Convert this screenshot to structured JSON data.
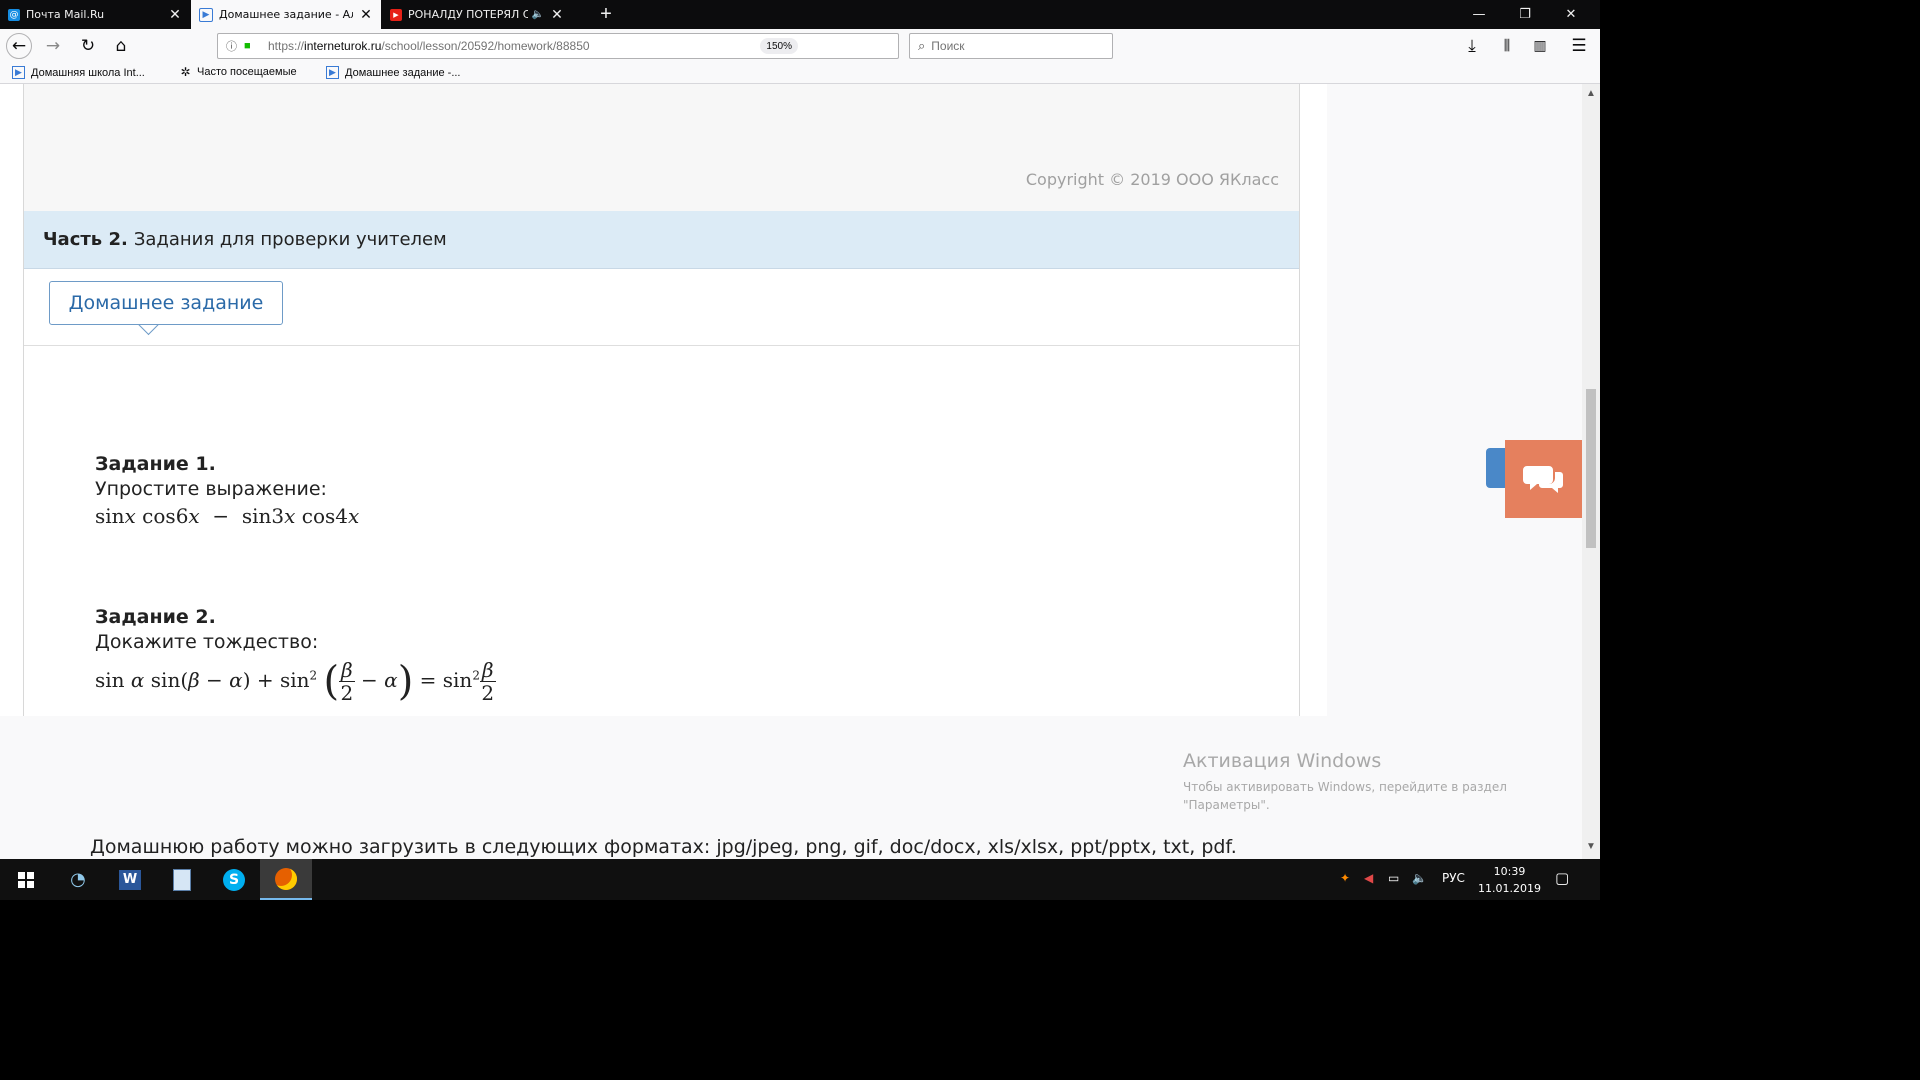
{
  "browser": {
    "tabs": [
      {
        "title": "Почта Mail.Ru",
        "active": false
      },
      {
        "title": "Домашнее задание - Алгебр",
        "active": true
      },
      {
        "title": "РОНАЛДУ ПОТЕРЯЛ СВОИ",
        "active": false
      }
    ],
    "window_controls": {
      "minimize": "—",
      "maximize": "❐",
      "close": "✕"
    },
    "url": {
      "scheme": "https://",
      "host": "interneturok.ru",
      "path": "/school/lesson/20592/homework/88850"
    },
    "zoom": "150%",
    "search_placeholder": "Поиск",
    "bookmarks": [
      "Домашняя школа Int...",
      "Часто посещаемые",
      "Домашнее задание -..."
    ]
  },
  "page": {
    "copyright": "Copyright © 2019 ООО ЯКласс",
    "section_label": "Часть 2.",
    "section_title": "Задания для проверки учителем",
    "homework_tab": "Домашнее задание",
    "task1": {
      "title": "Задание 1.",
      "text": "Упростите выражение:"
    },
    "task2": {
      "title": "Задание 2.",
      "text": "Докажите тождество:"
    },
    "formats": "Домашнюю работу можно загрузить в следующих форматах: jpg/jpeg, png, gif, doc/docx, xls/xlsx, ppt/pptx, txt, pdf."
  },
  "watermark": {
    "title": "Активация Windows",
    "line1": "Чтобы активировать Windows, перейдите в раздел",
    "line2": "\"Параметры\"."
  },
  "taskbar": {
    "language": "РУС",
    "time": "10:39",
    "date": "11.01.2019"
  },
  "colors": {
    "section_bg": "#dcebf6",
    "tab_border": "#6e9bc7",
    "chat_button": "#e5805e",
    "print_button": "#4a88c8"
  }
}
